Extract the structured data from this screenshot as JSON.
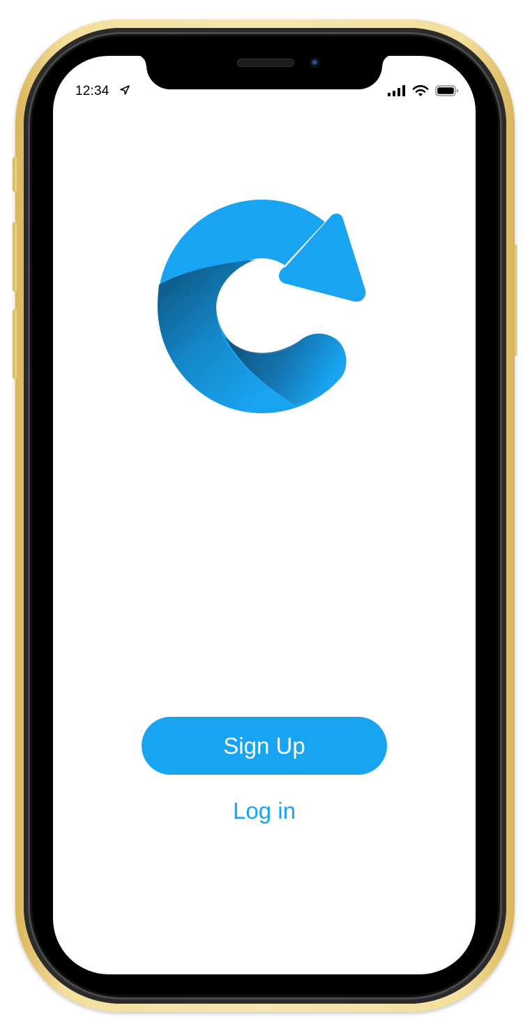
{
  "status_bar": {
    "time": "12:34",
    "icons": [
      "location-arrow-icon",
      "cellular-signal-icon",
      "wifi-icon",
      "battery-icon"
    ]
  },
  "logo": {
    "icon": "refresh-arrow-logo"
  },
  "actions": {
    "signup_label": "Sign Up",
    "login_label": "Log in"
  },
  "colors": {
    "accent": "#18a4f1",
    "accent_dark": "#0d4f78",
    "frame_gold": "#f3df9d",
    "bezel": "#000000",
    "screen_bg": "#ffffff"
  }
}
